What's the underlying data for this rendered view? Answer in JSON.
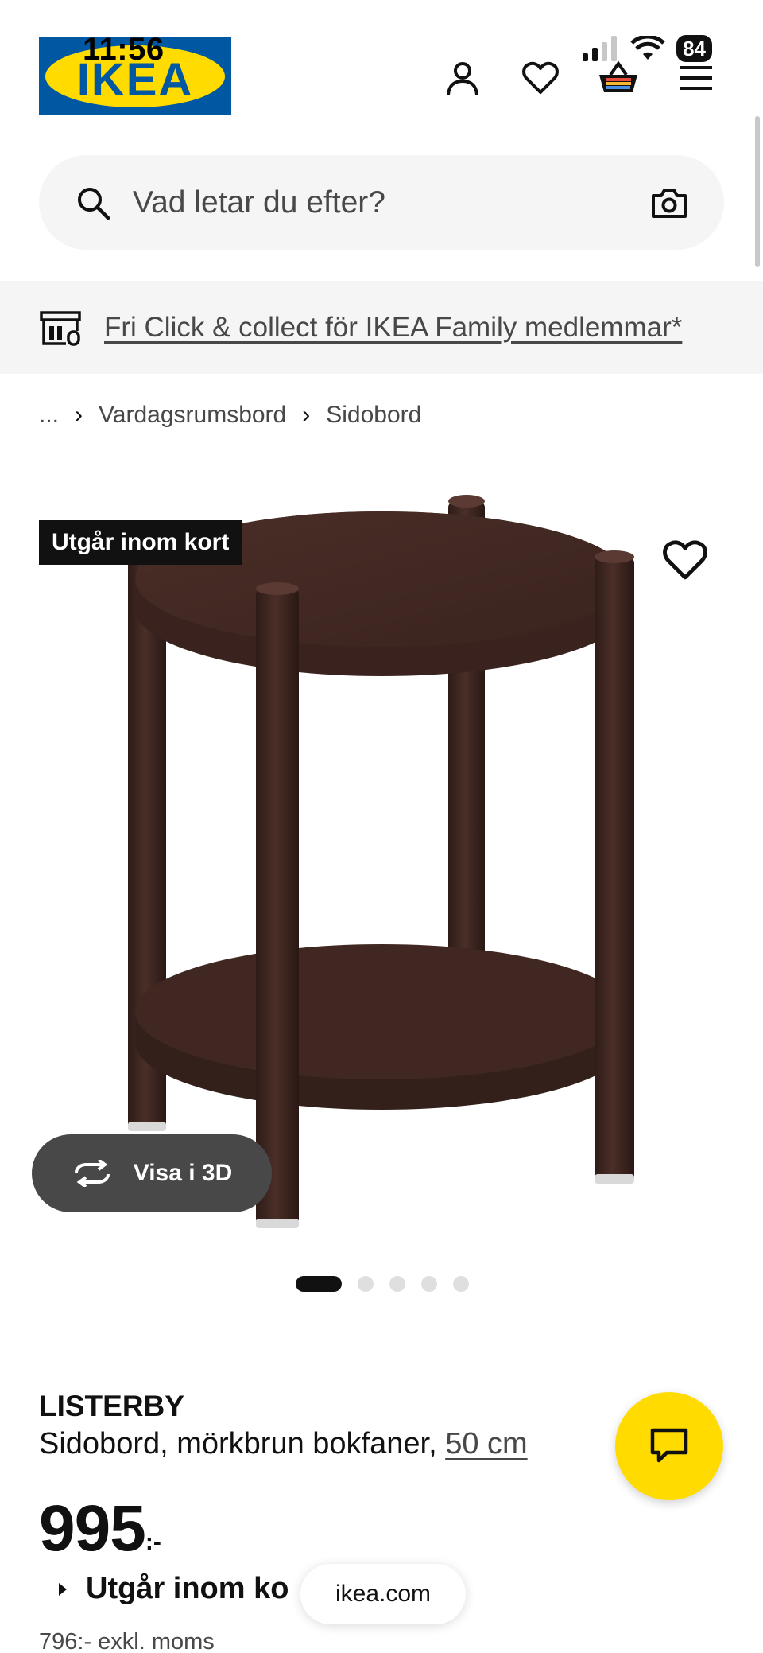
{
  "status_bar": {
    "time": "11:56",
    "battery": "84"
  },
  "header": {
    "logo_text": "IKEA",
    "icons": [
      "profile-icon",
      "heart-icon",
      "basket-icon",
      "menu-icon"
    ]
  },
  "search": {
    "placeholder": "Vad letar du efter?"
  },
  "banner": {
    "text": "Fri Click & collect för IKEA Family medlemmar*"
  },
  "breadcrumb": {
    "ellipsis": "...",
    "items": [
      "Vardagsrumsbord",
      "Sidobord"
    ]
  },
  "gallery": {
    "badge": "Utgår inom kort",
    "view_3d_label": "Visa i 3D",
    "image_count": 5,
    "active_index": 0
  },
  "product": {
    "name": "LISTERBY",
    "description": "Sidobord, mörkbrun bokfaner,",
    "measure": "50 cm",
    "price": "995",
    "price_suffix": ":-",
    "availability": "Utgår inom ko",
    "price_excl_vat": "796:- exkl. moms"
  },
  "browser": {
    "url": "ikea.com"
  },
  "colors": {
    "brand_blue": "#0058a3",
    "brand_yellow": "#ffdb00",
    "wood_dark": "#3b2420"
  }
}
